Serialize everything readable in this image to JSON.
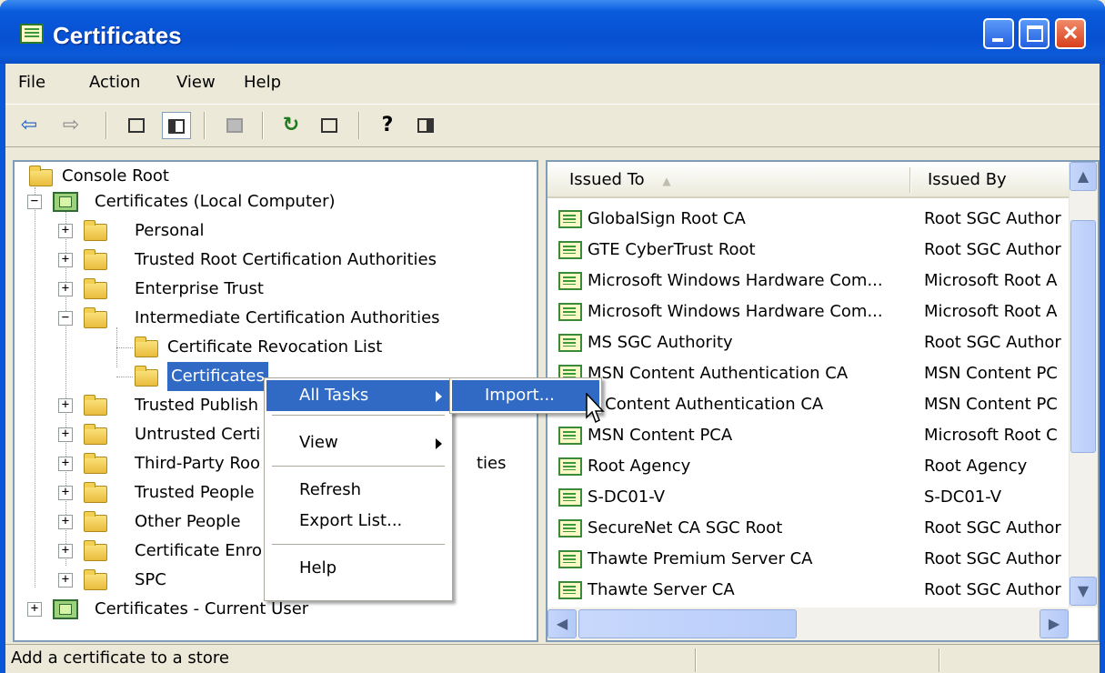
{
  "window": {
    "title": "Certificates"
  },
  "menubar": {
    "items": [
      "File",
      "Action",
      "View",
      "Help"
    ]
  },
  "toolbar": {
    "icons": [
      "back-arrow-icon",
      "forward-arrow-icon",
      "up-folder-icon",
      "show-hide-tree-icon",
      "delete-icon",
      "refresh-icon",
      "export-list-icon",
      "help-icon",
      "action-pane-icon"
    ],
    "back_glyph": "⇦",
    "forward_glyph": "⇨",
    "up_glyph": "⬑",
    "refresh_glyph": "↻",
    "help_glyph": "?"
  },
  "tree": {
    "items": [
      {
        "label": "Console Root"
      },
      {
        "label": "Certificates (Local Computer)"
      },
      {
        "label": "Personal"
      },
      {
        "label": "Trusted Root Certification Authorities"
      },
      {
        "label": "Enterprise Trust"
      },
      {
        "label": "Intermediate Certification Authorities"
      },
      {
        "label": "Certificate Revocation List"
      },
      {
        "label": "Certificates"
      },
      {
        "label": "Trusted Publish"
      },
      {
        "label": "Untrusted Certi"
      },
      {
        "label": "Third-Party Roo"
      },
      {
        "label": "ties"
      },
      {
        "label": "Trusted People"
      },
      {
        "label": "Other People"
      },
      {
        "label": "Certificate Enro"
      },
      {
        "label": "SPC"
      },
      {
        "label": "Certificates - Current User"
      }
    ],
    "expand_plus": "+",
    "expand_minus": "−"
  },
  "list": {
    "columns": [
      "Issued To",
      "Issued By"
    ],
    "sort_glyph": "▲",
    "rows": [
      {
        "issued_to": "GlobalSign Root CA",
        "issued_by": "Root SGC Author"
      },
      {
        "issued_to": "GTE CyberTrust Root",
        "issued_by": "Root SGC Author"
      },
      {
        "issued_to": "Microsoft Windows Hardware Com...",
        "issued_by": "Microsoft Root A"
      },
      {
        "issued_to": "Microsoft Windows Hardware Com...",
        "issued_by": "Microsoft Root A"
      },
      {
        "issued_to": "MS SGC Authority",
        "issued_by": "Root SGC Author"
      },
      {
        "issued_to": "MSN Content Authentication CA",
        "issued_by": "MSN Content PC"
      },
      {
        "issued_to": "N Content Authentication CA",
        "issued_by": "MSN Content PC"
      },
      {
        "issued_to": "MSN Content PCA",
        "issued_by": "Microsoft Root C"
      },
      {
        "issued_to": "Root Agency",
        "issued_by": "Root Agency"
      },
      {
        "issued_to": "S-DC01-V",
        "issued_by": "S-DC01-V"
      },
      {
        "issued_to": "SecureNet CA SGC Root",
        "issued_by": "Root SGC Author"
      },
      {
        "issued_to": "Thawte Premium Server CA",
        "issued_by": "Root SGC Author"
      },
      {
        "issued_to": "Thawte Server CA",
        "issued_by": "Root SGC Author"
      }
    ],
    "scroll_up": "▲",
    "scroll_down": "▼",
    "scroll_left": "◀",
    "scroll_right": "▶"
  },
  "context_menu": {
    "items": [
      "All Tasks",
      "View",
      "Refresh",
      "Export List...",
      "Help"
    ]
  },
  "submenu": {
    "items": [
      "Import..."
    ]
  },
  "statusbar": {
    "text": "Add a certificate to a store"
  },
  "colors": {
    "selection": "#316ac5",
    "titlebar": "#0a56d8",
    "face": "#ece9d8"
  }
}
